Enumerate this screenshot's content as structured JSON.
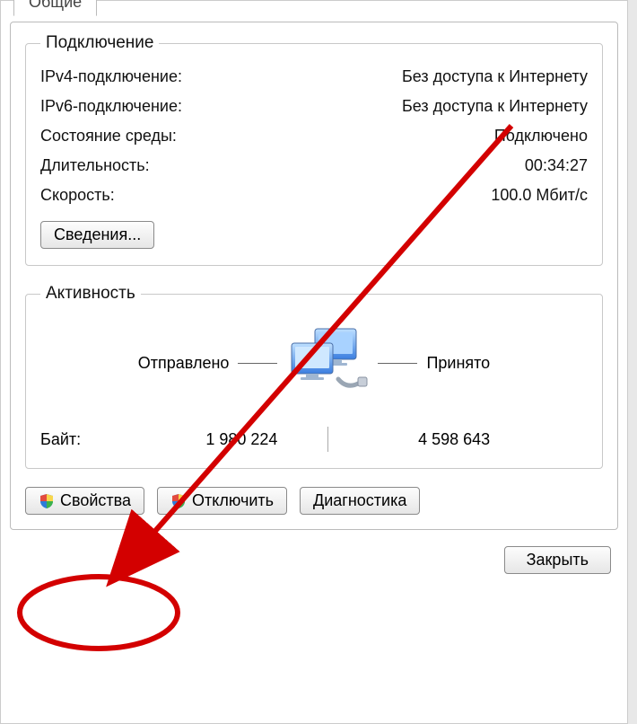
{
  "tab": {
    "label": "Общие"
  },
  "connection": {
    "legend": "Подключение",
    "ipv4_label": "IPv4-подключение:",
    "ipv4_value": "Без доступа к Интернету",
    "ipv6_label": "IPv6-подключение:",
    "ipv6_value": "Без доступа к Интернету",
    "media_label": "Состояние среды:",
    "media_value": "Подключено",
    "duration_label": "Длительность:",
    "duration_value": "00:34:27",
    "speed_label": "Скорость:",
    "speed_value": "100.0 Мбит/с",
    "details_button": "Сведения..."
  },
  "activity": {
    "legend": "Активность",
    "sent_label": "Отправлено",
    "received_label": "Принято",
    "bytes_label": "Байт:",
    "bytes_sent": "1 980 224",
    "bytes_received": "4 598 643"
  },
  "buttons": {
    "properties": "Свойства",
    "disable": "Отключить",
    "diagnose": "Диагностика",
    "close": "Закрыть"
  }
}
